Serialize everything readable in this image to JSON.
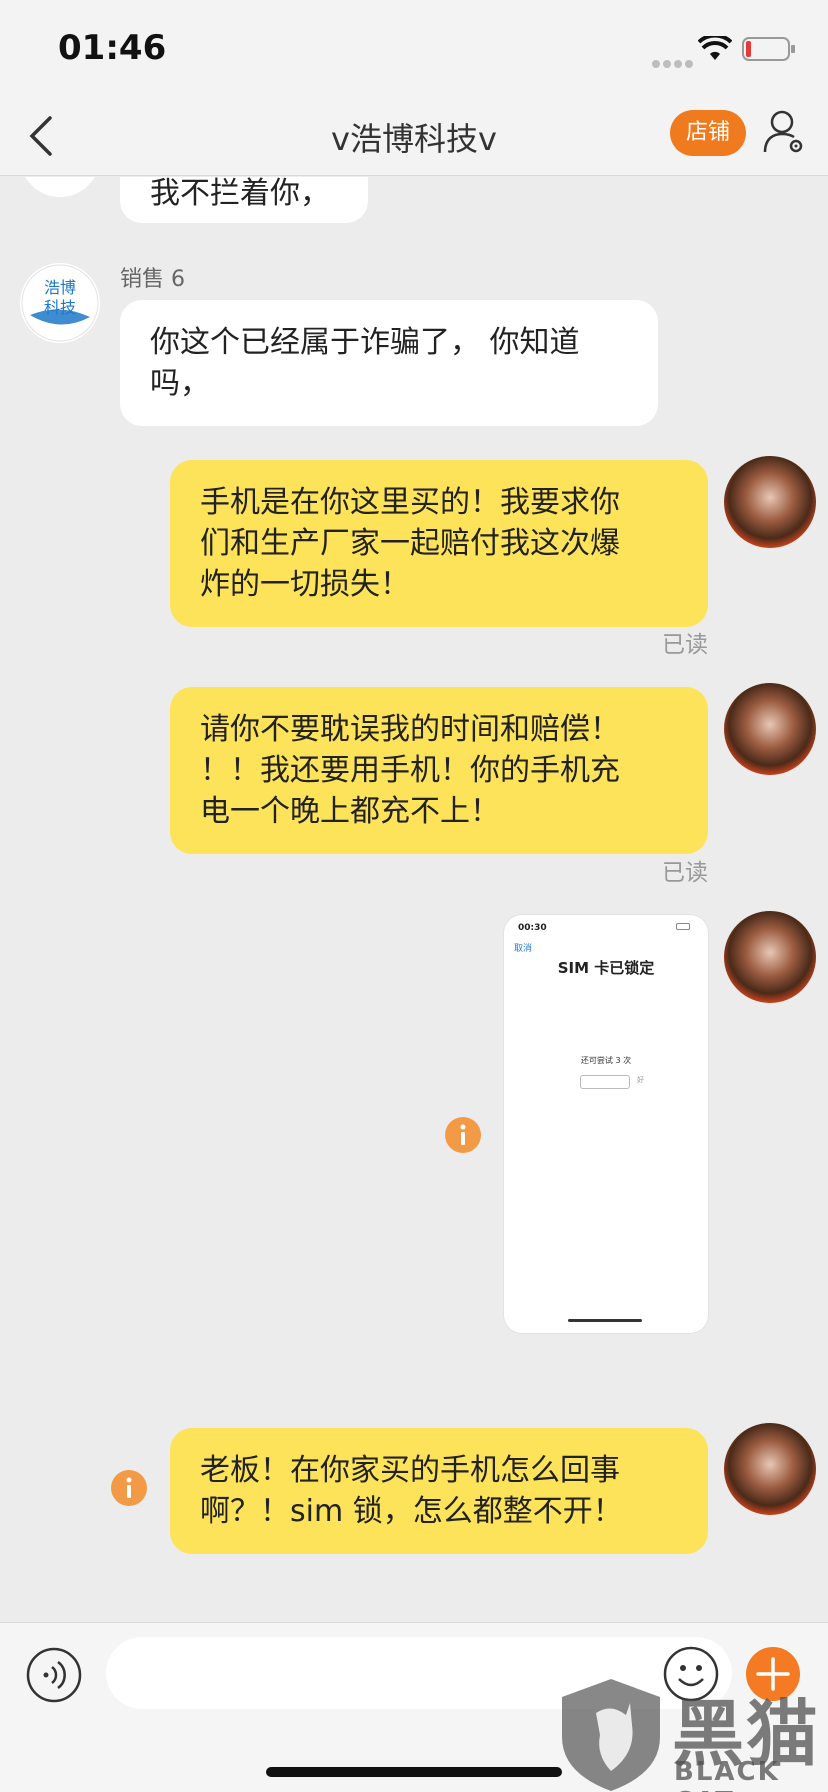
{
  "status_bar": {
    "time": "01:46"
  },
  "nav": {
    "title": "v浩博科技v",
    "shop_label": "店铺"
  },
  "store_avatar": {
    "line1": "浩博",
    "line2": "科技"
  },
  "messages": [
    {
      "type": "incoming",
      "text": "我不拦着你，"
    },
    {
      "type": "incoming",
      "sender": "销售 6",
      "text_lines": [
        "你这个已经属于诈骗了， 你知道",
        "吗，"
      ]
    },
    {
      "type": "outgoing",
      "text_lines": [
        "手机是在你这里买的！我要求你",
        "们和生产厂家一起赔付我这次爆",
        "炸的一切损失！"
      ],
      "status": "已读"
    },
    {
      "type": "outgoing",
      "text_lines": [
        "请你不要耽误我的时间和赔偿！",
        "！！我还要用手机！你的手机充",
        "电一个晚上都充不上！"
      ],
      "status": "已读"
    },
    {
      "type": "outgoing-image",
      "image": {
        "time": "00:30",
        "cancel": "取消",
        "title": "SIM 卡已锁定",
        "attempts": "还可尝试 3 次",
        "field_hint": "好"
      }
    },
    {
      "type": "outgoing",
      "text_lines": [
        "老板！在你家买的手机怎么回事",
        "啊？！sim 锁，怎么都整不开！"
      ]
    }
  ],
  "input": {
    "placeholder": ""
  },
  "watermark": {
    "cn": "黑猫",
    "en": "BLACK CAT"
  },
  "colors": {
    "accent": "#f07b1e",
    "outgoing_bubble": "#fde35a",
    "background": "#ececec"
  }
}
